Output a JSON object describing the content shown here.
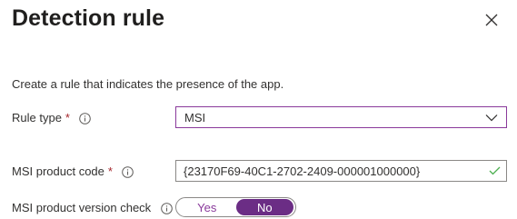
{
  "panel": {
    "title": "Detection rule",
    "close_icon": "close-icon"
  },
  "description": "Create a rule that indicates the presence of the app.",
  "rule_type": {
    "label": "Rule type",
    "required_marker": "*",
    "info_icon": "info-icon",
    "selected_value": "MSI",
    "dropdown_icon": "chevron-down-icon"
  },
  "msi_product_code": {
    "label": "MSI product code",
    "required_marker": "*",
    "info_icon": "info-icon",
    "value": "{23170F69-40C1-2702-2409-000001000000}",
    "validation_icon": "checkmark-icon",
    "valid": true
  },
  "msi_version_check": {
    "label": "MSI product version check",
    "info_icon": "info-icon",
    "options": [
      "Yes",
      "No"
    ],
    "selected": "No"
  },
  "colors": {
    "accent": "#6b2d85",
    "accent_text": "#8a3a9b",
    "required": "#a4262c",
    "valid_check": "#4caf50",
    "text": "#323130"
  }
}
